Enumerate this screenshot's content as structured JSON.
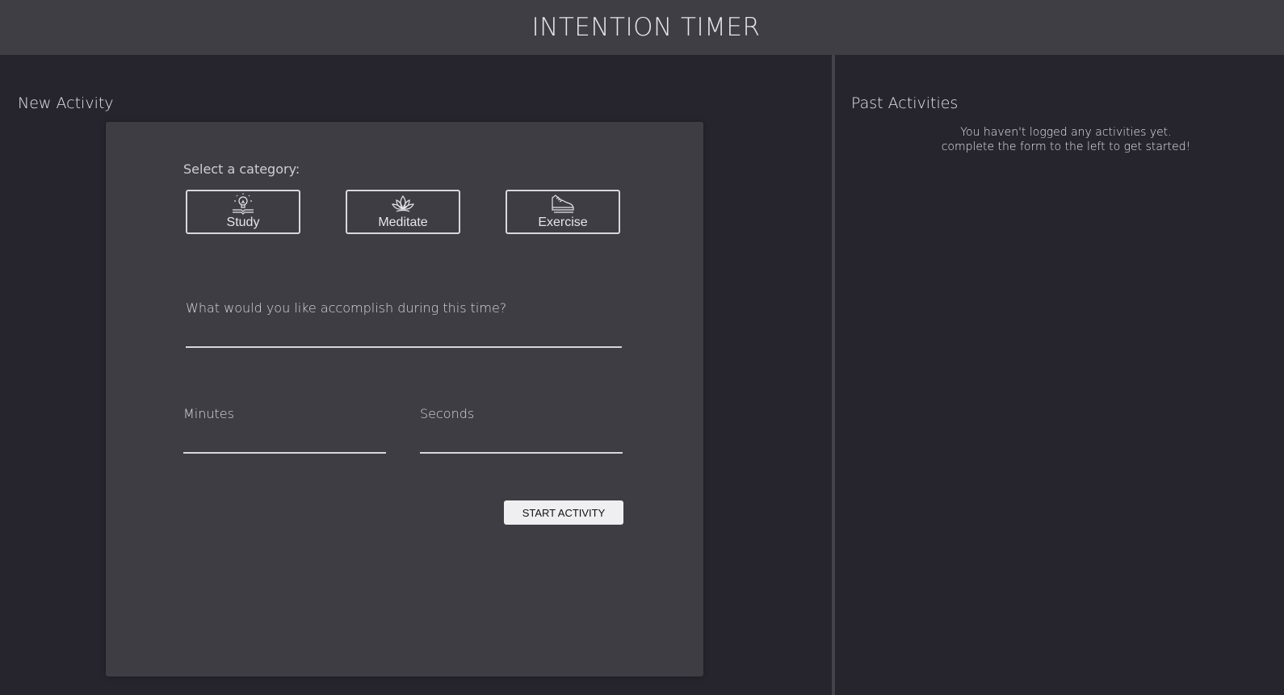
{
  "header": {
    "title": "INTENTION TIMER"
  },
  "new_activity": {
    "title": "New Activity",
    "category_label": "Select a category:",
    "categories": [
      {
        "label": "Study",
        "icon": "lightbulb-book-icon"
      },
      {
        "label": "Meditate",
        "icon": "lotus-icon"
      },
      {
        "label": "Exercise",
        "icon": "sneaker-icon"
      }
    ],
    "description_label": "What would you like accomplish during this time?",
    "description_value": "",
    "minutes_label": "Minutes",
    "minutes_value": "",
    "seconds_label": "Seconds",
    "seconds_value": "",
    "start_label": "START ACTIVITY"
  },
  "past_activities": {
    "title": "Past Activities",
    "empty_line1": "You haven't logged any activities yet.",
    "empty_line2": "complete the form to the left to get started!"
  },
  "colors": {
    "header_bg": "#403e45",
    "page_bg": "#26252d",
    "card_bg": "#3f3d44",
    "button_bg": "#efeff1"
  }
}
